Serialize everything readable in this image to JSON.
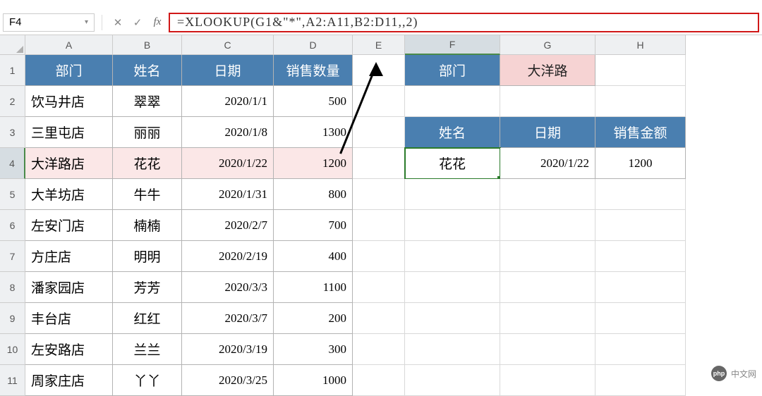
{
  "namebox": {
    "value": "F4",
    "dropdown_glyph": "▾"
  },
  "fbar": {
    "cancel_glyph": "✕",
    "accept_glyph": "✓",
    "fx_glyph": "fx",
    "formula": "=XLOOKUP(G1&\"*\",A2:A11,B2:D11,,2)"
  },
  "cols": [
    "A",
    "B",
    "C",
    "D",
    "E",
    "F",
    "G",
    "H"
  ],
  "rows": [
    "1",
    "2",
    "3",
    "4",
    "5",
    "6",
    "7",
    "8",
    "9",
    "10",
    "11"
  ],
  "active": {
    "col": "F",
    "row": "4"
  },
  "left": {
    "headers": [
      "部门",
      "姓名",
      "日期",
      "销售数量"
    ],
    "data": [
      {
        "dept": "饮马井店",
        "name": "翠翠",
        "date": "2020/1/1",
        "qty": "500"
      },
      {
        "dept": "三里屯店",
        "name": "丽丽",
        "date": "2020/1/8",
        "qty": "1300"
      },
      {
        "dept": "大洋路店",
        "name": "花花",
        "date": "2020/1/22",
        "qty": "1200"
      },
      {
        "dept": "大羊坊店",
        "name": "牛牛",
        "date": "2020/1/31",
        "qty": "800"
      },
      {
        "dept": "左安门店",
        "name": "楠楠",
        "date": "2020/2/7",
        "qty": "700"
      },
      {
        "dept": "方庄店",
        "name": "明明",
        "date": "2020/2/19",
        "qty": "400"
      },
      {
        "dept": "潘家园店",
        "name": "芳芳",
        "date": "2020/3/3",
        "qty": "1100"
      },
      {
        "dept": "丰台店",
        "name": "红红",
        "date": "2020/3/7",
        "qty": "200"
      },
      {
        "dept": "左安路店",
        "name": "兰兰",
        "date": "2020/3/19",
        "qty": "300"
      },
      {
        "dept": "周家庄店",
        "name": "丫丫",
        "date": "2020/3/25",
        "qty": "1000"
      }
    ]
  },
  "right": {
    "top_label": "部门",
    "top_value": "大洋路",
    "headers": [
      "姓名",
      "日期",
      "销售金额"
    ],
    "result": {
      "name": "花花",
      "date": "2020/1/22",
      "amount": "1200"
    }
  },
  "watermark": {
    "logo": "php",
    "text": "中文网"
  }
}
